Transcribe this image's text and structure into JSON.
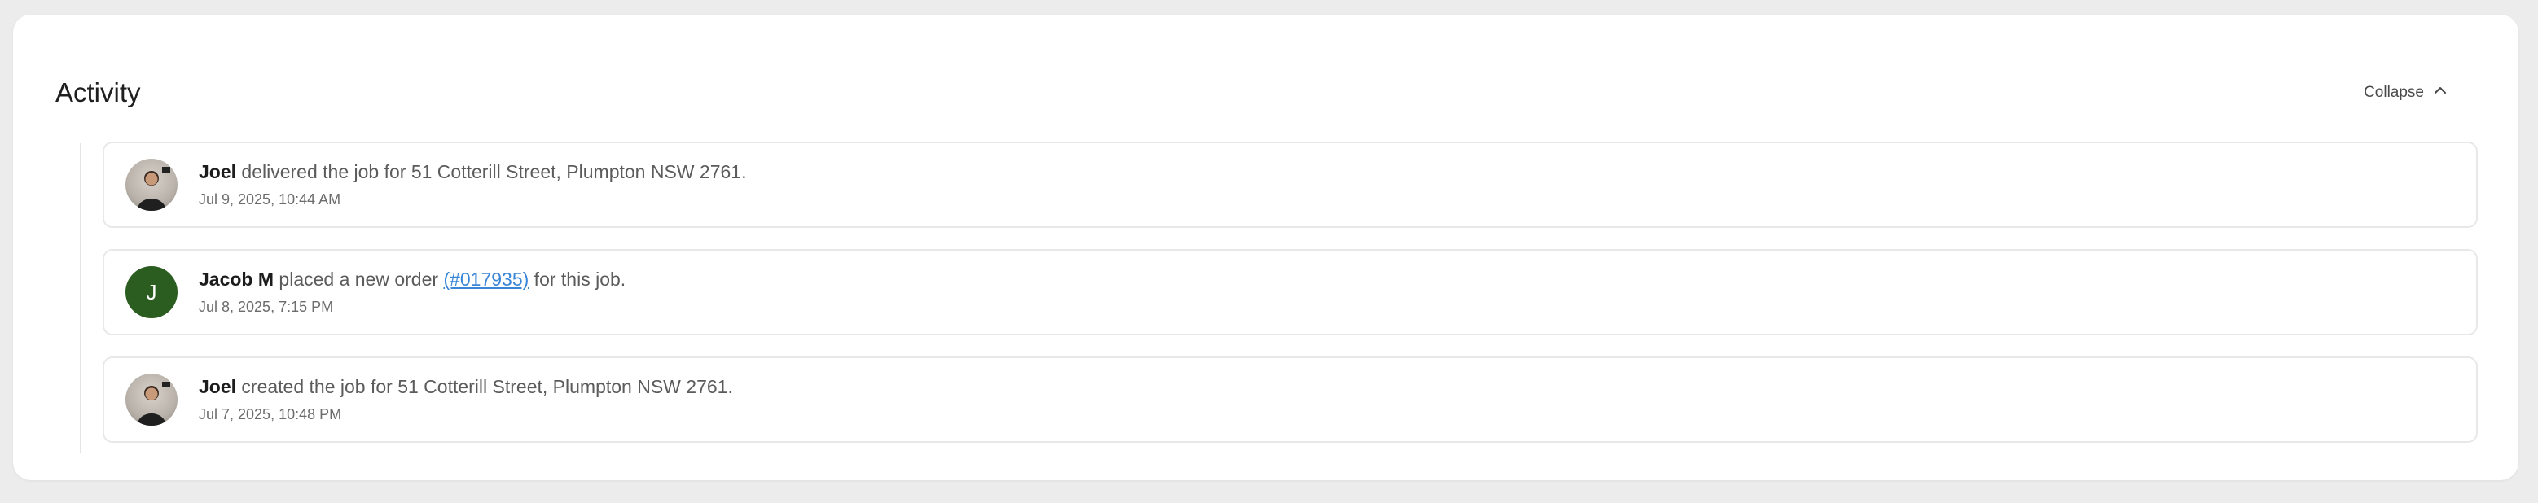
{
  "activity": {
    "title": "Activity",
    "collapse_label": "Collapse",
    "collapse_icon": "chevron-up-icon",
    "items": [
      {
        "actor": "Joel",
        "text_before": " delivered the job for 51 Cotterill Street, Plumpton NSW 2761.",
        "link": "",
        "text_after": "",
        "timestamp": "Jul 9, 2025, 10:44 AM",
        "avatar_type": "photo",
        "avatar_initial": ""
      },
      {
        "actor": "Jacob M",
        "text_before": " placed a new order ",
        "link": "(#017935)",
        "text_after": " for this job.",
        "timestamp": "Jul 8, 2025, 7:15 PM",
        "avatar_type": "initial",
        "avatar_initial": "J",
        "avatar_color": "#2a5d1f"
      },
      {
        "actor": "Joel",
        "text_before": " created the job for 51 Cotterill Street, Plumpton NSW 2761.",
        "link": "",
        "text_after": "",
        "timestamp": "Jul 7, 2025, 10:48 PM",
        "avatar_type": "photo",
        "avatar_initial": ""
      }
    ]
  }
}
